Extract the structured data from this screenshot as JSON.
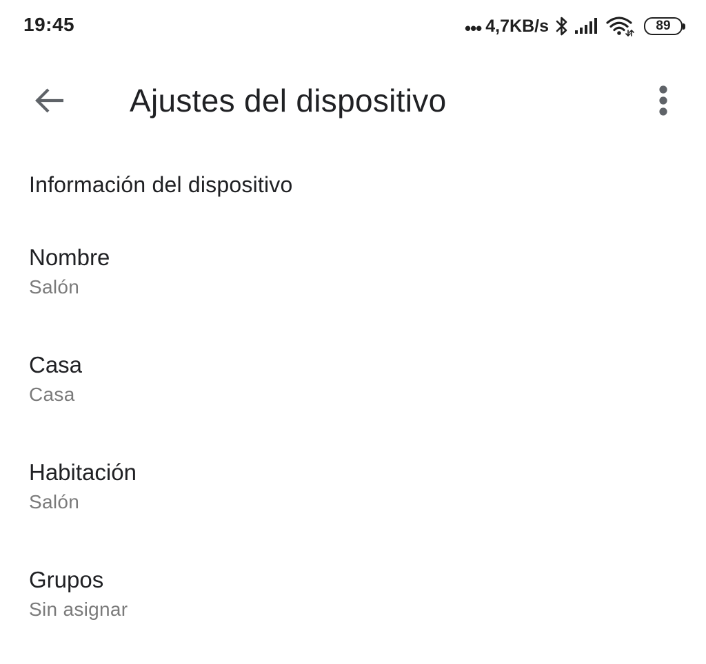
{
  "status_bar": {
    "time": "19:45",
    "dots": "•••",
    "network_speed": "4,7KB/s",
    "battery_level": "89",
    "icons": [
      "bluetooth-icon",
      "cell-signal-icon",
      "wifi-icon",
      "battery-icon"
    ]
  },
  "app_bar": {
    "title": "Ajustes del dispositivo",
    "back_icon": "arrow-back-icon",
    "overflow_icon": "more-vert-icon"
  },
  "section": {
    "header": "Información del dispositivo"
  },
  "settings": [
    {
      "title": "Nombre",
      "value": "Salón"
    },
    {
      "title": "Casa",
      "value": "Casa"
    },
    {
      "title": "Habitación",
      "value": "Salón"
    },
    {
      "title": "Grupos",
      "value": "Sin asignar"
    }
  ],
  "colors": {
    "background": "#ffffff",
    "primary_text": "#202124",
    "secondary_text": "#7a7a7a",
    "icon": "#5f6368"
  }
}
